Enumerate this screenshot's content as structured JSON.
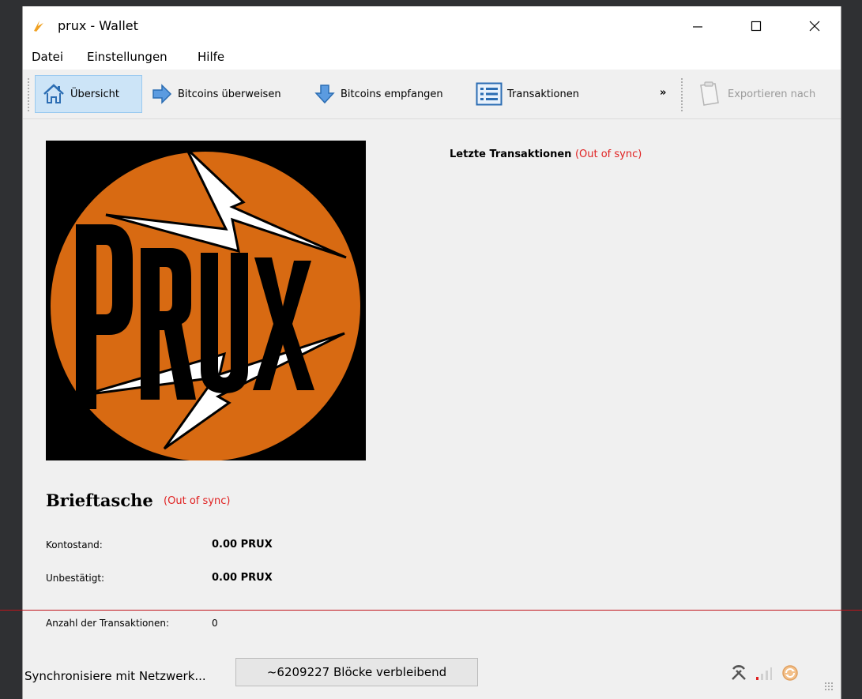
{
  "window": {
    "title": "prux - Wallet"
  },
  "menu": [
    "Datei",
    "Einstellungen",
    "Hilfe"
  ],
  "toolbar": {
    "items": [
      {
        "label": "Übersicht",
        "icon": "home-icon",
        "active": true
      },
      {
        "label": "Bitcoins überweisen",
        "icon": "send-arrow-icon",
        "active": false
      },
      {
        "label": "Bitcoins empfangen",
        "icon": "receive-arrow-icon",
        "active": false
      },
      {
        "label": "Transaktionen",
        "icon": "list-icon",
        "active": false
      }
    ],
    "more_label": "»",
    "export_label": "Exportieren nach"
  },
  "logo": {
    "text": "PRUX",
    "colors": {
      "circle": "#d86a12",
      "background": "#000000",
      "bolt": "#ffffff"
    }
  },
  "recent": {
    "title": "Letzte Transaktionen",
    "status": "(Out of sync)"
  },
  "wallet": {
    "title": "Brieftasche",
    "status": "(Out of sync)",
    "balance_label": "Kontostand:",
    "balance_value": "0.00 PRUX",
    "unconfirmed_label": "Unbestätigt:",
    "unconfirmed_value": "0.00 PRUX",
    "tx_count_label": "Anzahl der Transaktionen:",
    "tx_count_value": "0"
  },
  "status": {
    "sync_label": "Synchronisiere mit Netzwerk...",
    "progress_text": "~6209227 Blöcke verbleibend",
    "progress_fraction": 0,
    "icons": [
      "mining-icon",
      "signal-icon",
      "sync-icon"
    ]
  },
  "colors": {
    "out_of_sync": "#e02020",
    "active_tab": "#cce4f7"
  }
}
